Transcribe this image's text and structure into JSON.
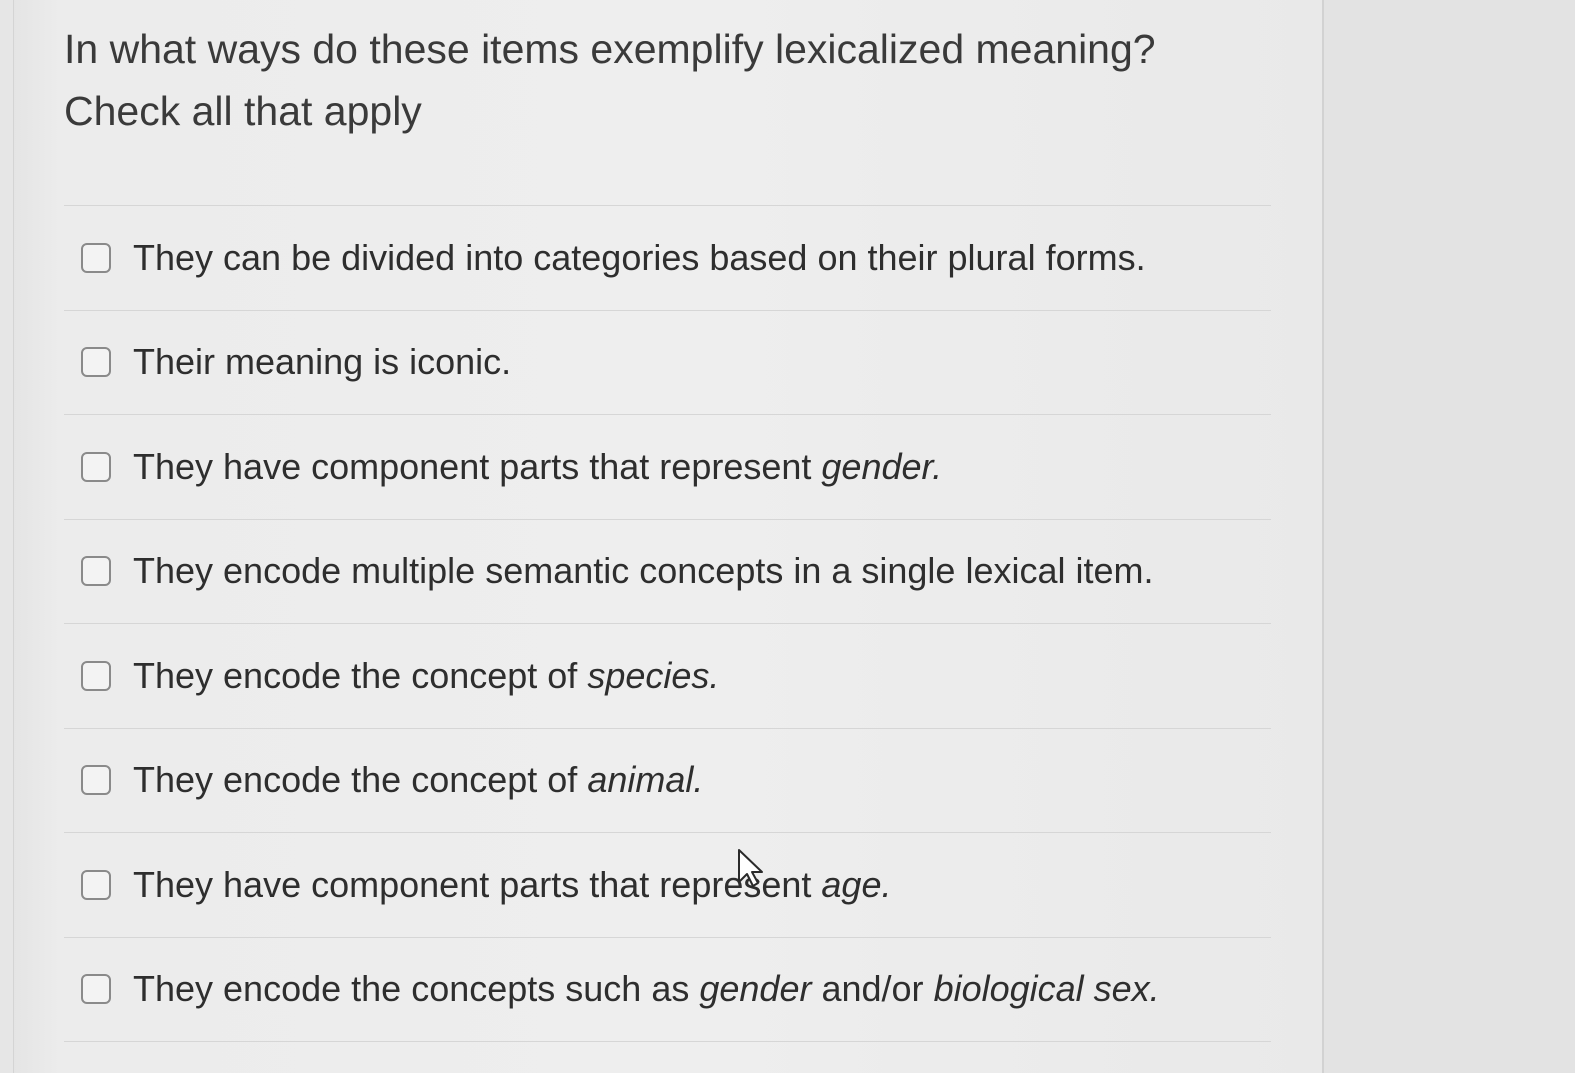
{
  "question": {
    "line1": "In what ways do these items exemplify lexicalized meaning?",
    "line2": "Check all that apply"
  },
  "options": [
    {
      "parts": [
        {
          "text": "They can be divided into categories based on their plural forms.",
          "italic": false
        }
      ]
    },
    {
      "parts": [
        {
          "text": "Their meaning is iconic.",
          "italic": false
        }
      ]
    },
    {
      "parts": [
        {
          "text": "They have component parts that represent ",
          "italic": false
        },
        {
          "text": "gender.",
          "italic": true
        }
      ]
    },
    {
      "parts": [
        {
          "text": "They encode multiple semantic concepts in a single lexical item.",
          "italic": false
        }
      ]
    },
    {
      "parts": [
        {
          "text": "They encode the concept of ",
          "italic": false
        },
        {
          "text": "species.",
          "italic": true
        }
      ]
    },
    {
      "parts": [
        {
          "text": "They encode the concept of ",
          "italic": false
        },
        {
          "text": "animal.",
          "italic": true
        }
      ]
    },
    {
      "parts": [
        {
          "text": "They have component parts that represent ",
          "italic": false
        },
        {
          "text": "age.",
          "italic": true
        }
      ]
    },
    {
      "parts": [
        {
          "text": "They encode the concepts such as ",
          "italic": false
        },
        {
          "text": "gender",
          "italic": true
        },
        {
          "text": " and/or ",
          "italic": false
        },
        {
          "text": "biological sex.",
          "italic": true
        }
      ]
    }
  ],
  "icons": {
    "checkbox": "empty-checkbox-icon",
    "cursor": "mouse-pointer-icon"
  }
}
